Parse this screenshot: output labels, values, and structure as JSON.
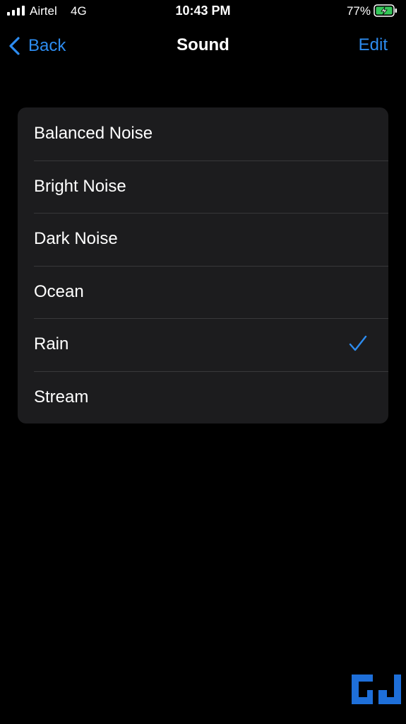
{
  "status_bar": {
    "carrier": "Airtel",
    "network": "4G",
    "time": "10:43 PM",
    "battery_percent": "77%"
  },
  "nav": {
    "back_label": "Back",
    "title": "Sound",
    "edit_label": "Edit"
  },
  "sounds": {
    "items": [
      {
        "label": "Balanced Noise",
        "selected": false
      },
      {
        "label": "Bright Noise",
        "selected": false
      },
      {
        "label": "Dark Noise",
        "selected": false
      },
      {
        "label": "Ocean",
        "selected": false
      },
      {
        "label": "Rain",
        "selected": true
      },
      {
        "label": "Stream",
        "selected": false
      }
    ]
  },
  "icons": {
    "signal": "cellular-signal-icon",
    "battery": "battery-charging-icon",
    "back": "chevron-left-icon",
    "check": "checkmark-icon",
    "logo": "watermark-logo"
  },
  "colors": {
    "background": "#000000",
    "card": "#1c1c1e",
    "separator": "#38383a",
    "accent": "#2d8cf0",
    "battery": "#34c759"
  }
}
